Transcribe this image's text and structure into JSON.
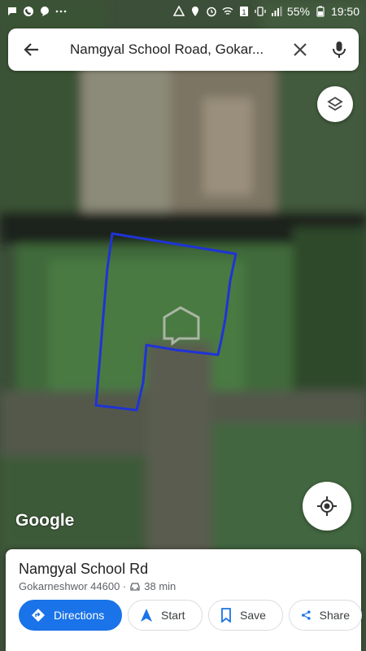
{
  "status": {
    "battery": "55%",
    "time": "19:50",
    "left_icons": [
      "sms-icon",
      "phone-icon",
      "chat-icon",
      "more-dots-icon"
    ],
    "right_icons": [
      "drive-icon",
      "location-icon",
      "alarm-icon",
      "wifi-icon",
      "sim-1-icon",
      "vibrate-icon",
      "signal-icon",
      "battery-icon"
    ]
  },
  "search": {
    "query": "Namgyal School Road, Gokar..."
  },
  "map": {
    "attribution": "Google",
    "accent_color": "#1a73e8",
    "outline_color": "#1f33d6"
  },
  "place": {
    "name": "Namgyal School Rd",
    "address": "Gokarneshwor 44600 ·",
    "drive_time": "38 min"
  },
  "actions": {
    "directions": "Directions",
    "start": "Start",
    "save": "Save",
    "share": "Share"
  }
}
